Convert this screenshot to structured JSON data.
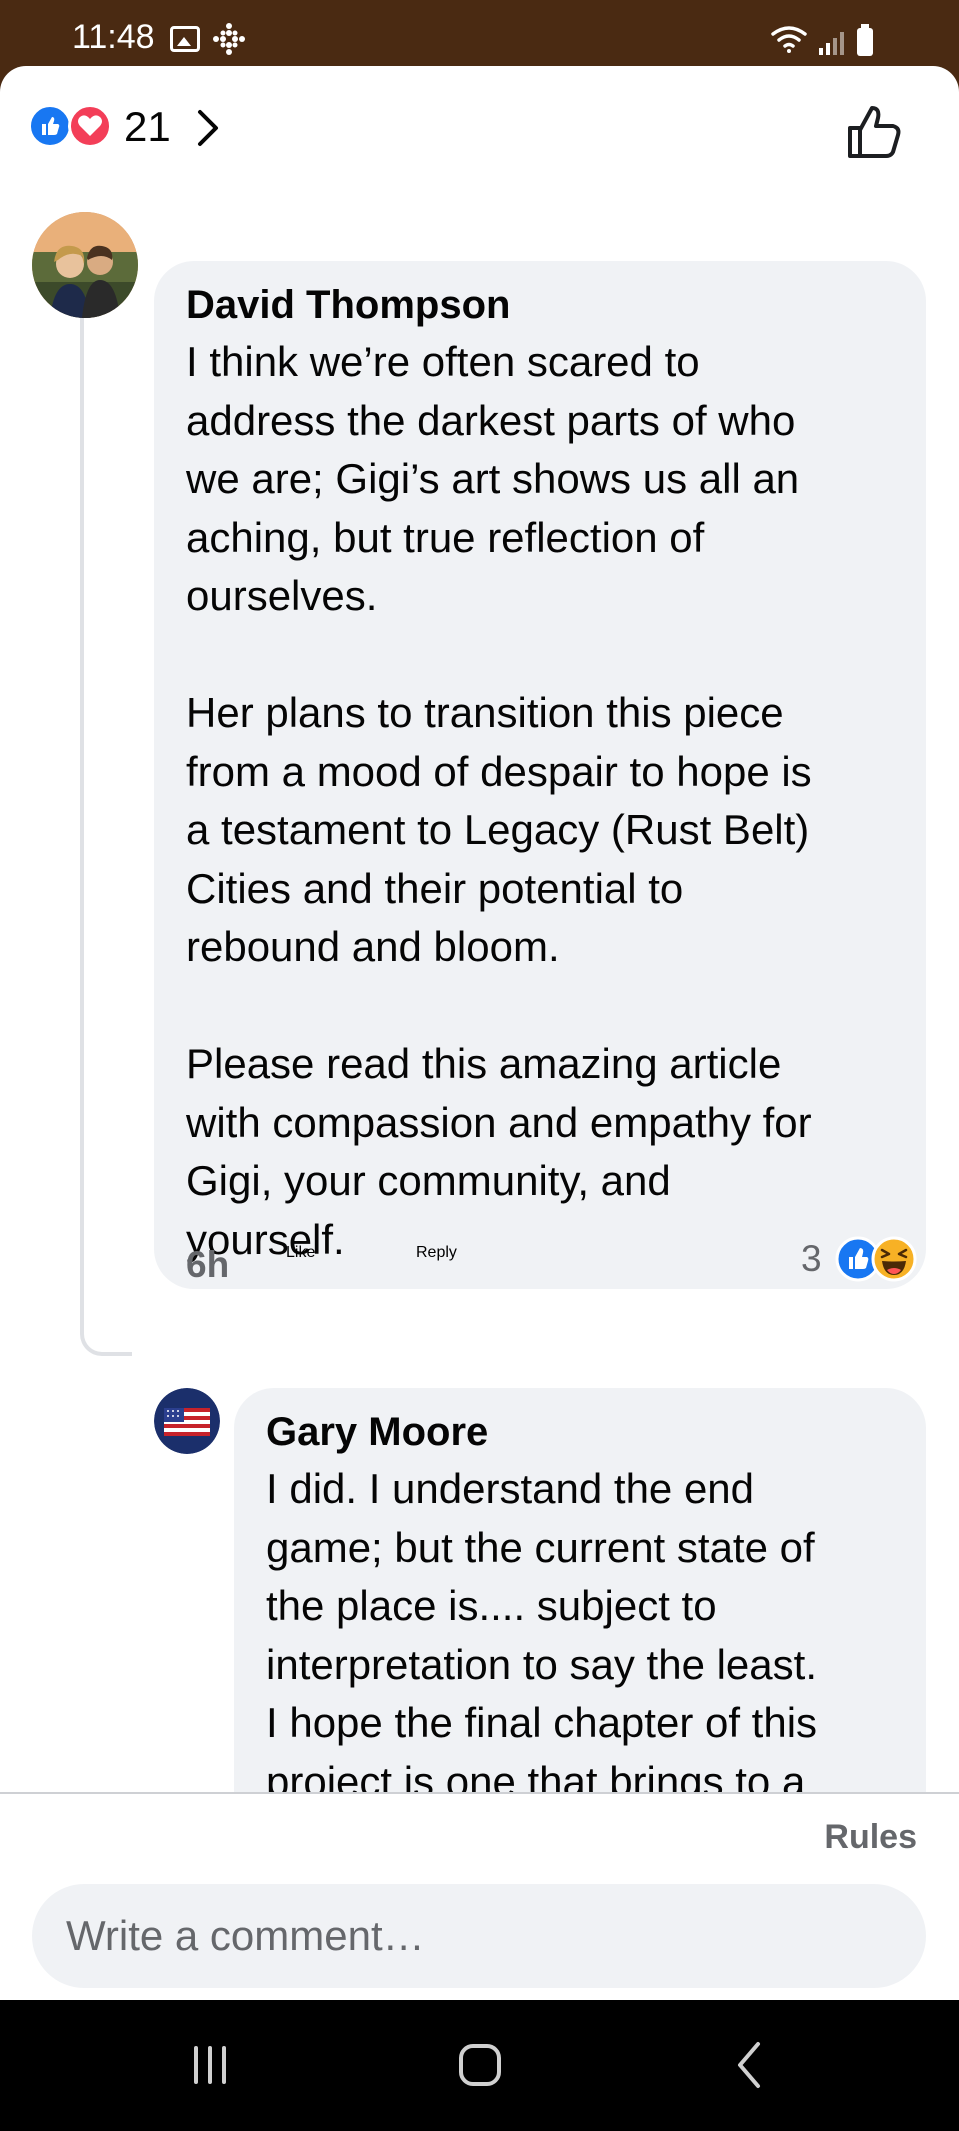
{
  "status_bar": {
    "time": "11:48"
  },
  "reactions": {
    "count": "21"
  },
  "comments": [
    {
      "author": "David Thompson",
      "text": "I think we’re often scared to\naddress the darkest parts of who\nwe are; Gigi’s art shows us all an\naching, but true reflection of\nourselves.\n\nHer plans to transition this piece\nfrom a mood of despair to hope is\na testament to Legacy (Rust Belt)\nCities and their potential to\nrebound and bloom.\n\nPlease read this amazing article\nwith compassion and empathy for\nGigi, your community, and\nyourself.",
      "time": "6h",
      "like_label": "Like",
      "reply_label": "Reply",
      "reaction_count": "3"
    }
  ],
  "replies": [
    {
      "author": "Gary Moore",
      "text": "I did. I understand the end\ngame; but the current state of\nthe place is.... subject to\ninterpretation to say the least.\nI hope the final chapter of this\nproject is one that brings to a\nclose to this controversy"
    }
  ],
  "footer": {
    "rules_label": "Rules",
    "comment_placeholder": "Write a comment…"
  },
  "colors": {
    "status_bar": "#4a2a12",
    "bubble": "#f0f2f5",
    "like_blue": "#1877f2",
    "love_red": "#f33e58",
    "meta_gray": "#65676b"
  },
  "icons": [
    "image-icon",
    "dots-icon",
    "wifi-icon",
    "signal-icon",
    "battery-icon",
    "like-reaction-icon",
    "love-reaction-icon",
    "chevron-right-icon",
    "thumbs-up-icon",
    "haha-reaction-icon",
    "recent-apps-icon",
    "home-icon",
    "back-icon"
  ]
}
